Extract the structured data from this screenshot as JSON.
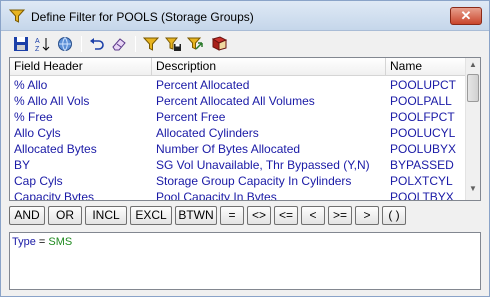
{
  "window": {
    "title": "Define Filter for POOLS (Storage Groups)",
    "close_glyph": "✕"
  },
  "toolbar": {
    "buttons": [
      {
        "icon": "save-icon"
      },
      {
        "icon": "sort-az-icon"
      },
      {
        "icon": "globe-icon"
      },
      {
        "icon": "undo-icon"
      },
      {
        "icon": "eraser-icon"
      },
      {
        "icon": "filter-icon"
      },
      {
        "icon": "filter-save-icon"
      },
      {
        "icon": "filter-apply-icon"
      },
      {
        "icon": "book-icon"
      }
    ]
  },
  "grid": {
    "columns": [
      "Field Header",
      "Description",
      "Name"
    ],
    "rows": [
      [
        "% Allo",
        "Percent Allocated",
        "POOLUPCT"
      ],
      [
        "% Allo All Vols",
        "Percent Allocated All Volumes",
        "POOLPALL"
      ],
      [
        "% Free",
        "Percent Free",
        "POOLFPCT"
      ],
      [
        "Allo Cyls",
        "Allocated Cylinders",
        "POOLUCYL"
      ],
      [
        "Allocated Bytes",
        "Number Of Bytes Allocated",
        "POOLUBYX"
      ],
      [
        "BY",
        "SG Vol Unavailable, Thr Bypassed (Y,N)",
        "BYPASSED"
      ],
      [
        "Cap Cyls",
        "Storage Group Capacity In Cylinders",
        "POLXTCYL"
      ],
      [
        "Capacity Bytes",
        "Pool Capacity In Bytes",
        "POOLTBYX"
      ]
    ],
    "scroll_up": "▲",
    "scroll_down": "▼"
  },
  "operators": [
    "AND",
    "OR",
    "INCL",
    "EXCL",
    "BTWN",
    "=",
    "<>",
    "<=",
    "<",
    ">=",
    ">",
    "( )"
  ],
  "expression": {
    "field": "Type",
    "op": " = ",
    "value": "SMS"
  },
  "colors": {
    "accent": "#1a1aa6",
    "value": "#1f8a1f",
    "titlebar": "#c5d6ea"
  }
}
